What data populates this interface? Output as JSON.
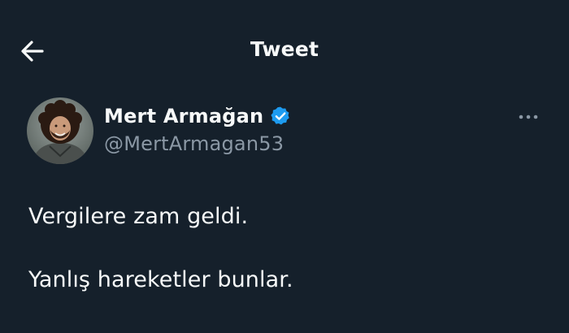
{
  "header": {
    "title": "Tweet",
    "back_icon": "arrow-left-icon"
  },
  "author": {
    "display_name": "Mert Armağan",
    "handle": "@MertArmagan53",
    "verified_icon": "verified-badge-icon",
    "verified_color": "#1d9bf0"
  },
  "more_icon": "more-horizontal-icon",
  "tweet": {
    "lines": [
      "Vergilere zam geldi.",
      "Yanlış hareketler bunlar."
    ]
  },
  "colors": {
    "background": "#15202b",
    "text": "#f7f9f9",
    "secondary_text": "#8b98a5"
  }
}
